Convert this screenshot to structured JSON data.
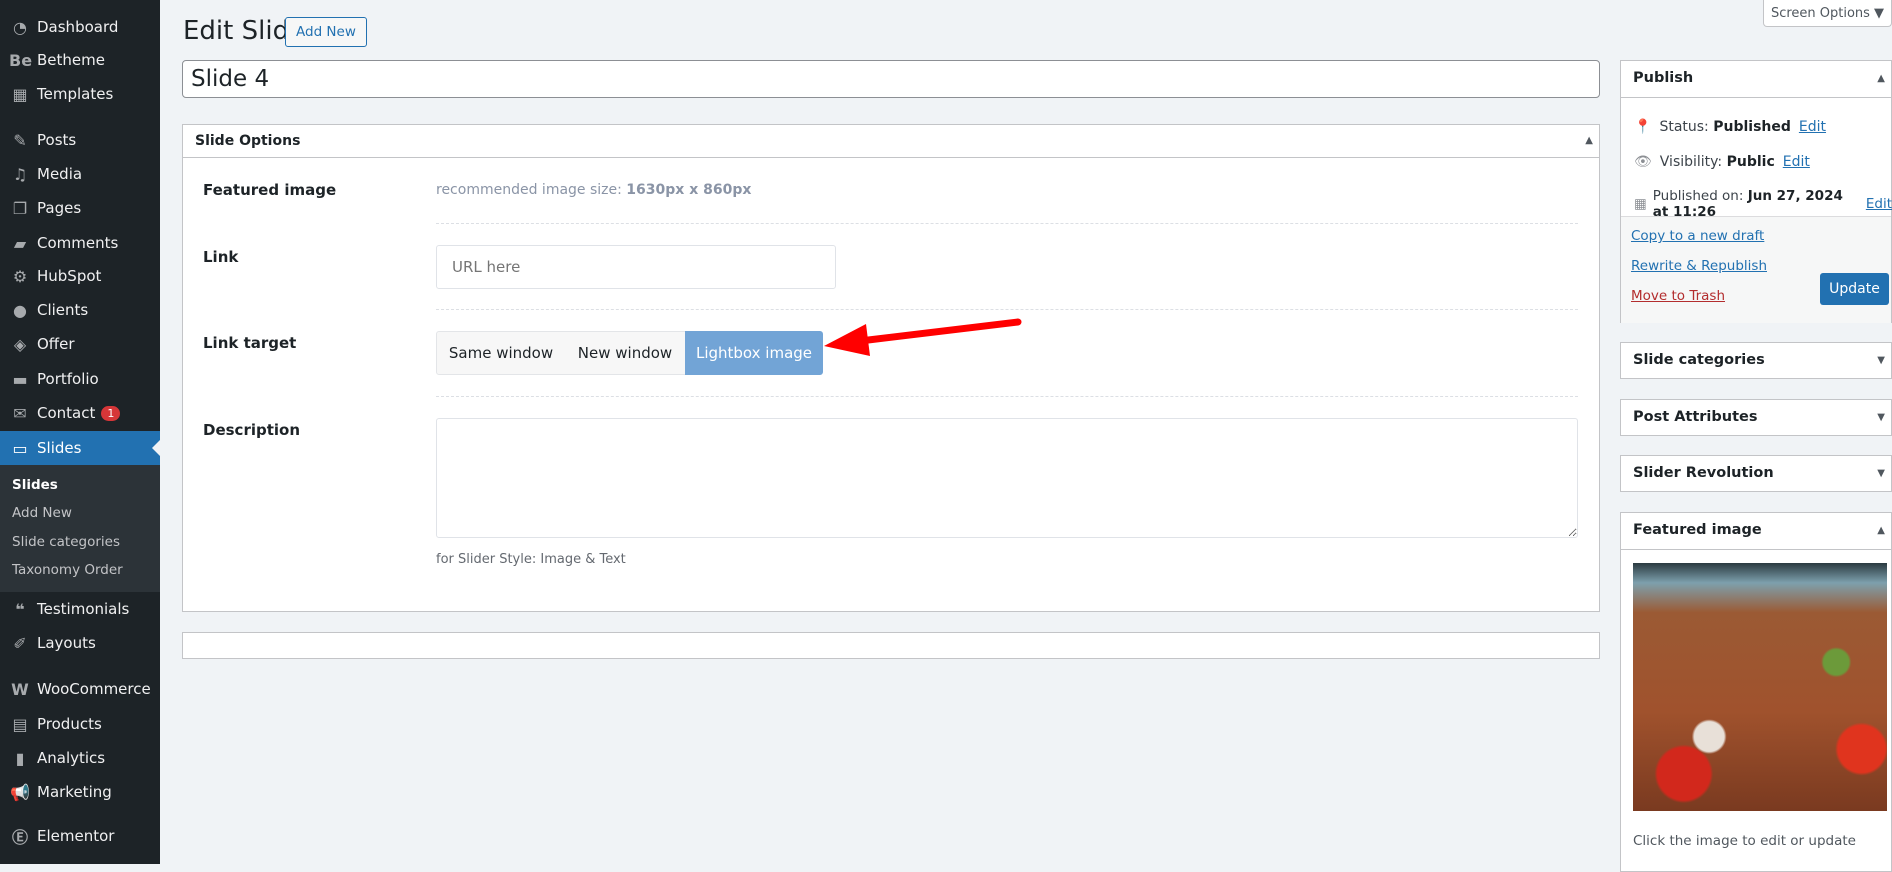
{
  "sidebar": {
    "items": [
      {
        "label": "Dashboard",
        "icon": "dashboard-icon",
        "glyph": "◔"
      },
      {
        "label": "Betheme",
        "icon": "betheme-icon",
        "glyph": "Be"
      },
      {
        "label": "Templates",
        "icon": "templates-icon",
        "glyph": "▦"
      },
      {
        "label": "Posts",
        "icon": "pin-icon",
        "glyph": "✎"
      },
      {
        "label": "Media",
        "icon": "media-icon",
        "glyph": "♫"
      },
      {
        "label": "Pages",
        "icon": "pages-icon",
        "glyph": "❐"
      },
      {
        "label": "Comments",
        "icon": "comment-icon",
        "glyph": "▰"
      },
      {
        "label": "HubSpot",
        "icon": "hubspot-icon",
        "glyph": "⚙"
      },
      {
        "label": "Clients",
        "icon": "clients-icon",
        "glyph": "●"
      },
      {
        "label": "Offer",
        "icon": "offer-icon",
        "glyph": "◈"
      },
      {
        "label": "Portfolio",
        "icon": "portfolio-icon",
        "glyph": "▬"
      },
      {
        "label": "Contact",
        "icon": "mail-icon",
        "glyph": "✉",
        "badge": "1"
      },
      {
        "label": "Slides",
        "icon": "slides-icon",
        "glyph": "▭",
        "active": true
      },
      {
        "label": "Testimonials",
        "icon": "quote-icon",
        "glyph": "❝"
      },
      {
        "label": "Layouts",
        "icon": "pencil-icon",
        "glyph": "✐"
      },
      {
        "label": "WooCommerce",
        "icon": "woocommerce-icon",
        "glyph": "W"
      },
      {
        "label": "Products",
        "icon": "archive-icon",
        "glyph": "▤"
      },
      {
        "label": "Analytics",
        "icon": "bar-chart-icon",
        "glyph": "▮"
      },
      {
        "label": "Marketing",
        "icon": "megaphone-icon",
        "glyph": "📢"
      },
      {
        "label": "Elementor",
        "icon": "elementor-icon",
        "glyph": "Ⓔ"
      }
    ],
    "submenu": [
      "Slides",
      "Add New",
      "Slide categories",
      "Taxonomy Order"
    ]
  },
  "header": {
    "title": "Edit Slide",
    "add_new": "Add New",
    "screen_options": "Screen Options ▼"
  },
  "post_title": "Slide 4",
  "slide_options": {
    "title": "Slide Options",
    "featured_label": "Featured image",
    "featured_hint": "recommended image size: ",
    "featured_size": "1630px x 860px",
    "link_label": "Link",
    "link_placeholder": "URL here",
    "target_label": "Link target",
    "targets": [
      "Same window",
      "New window",
      "Lightbox image"
    ],
    "selected_target": "Lightbox image",
    "description_label": "Description",
    "description_value": "",
    "description_hint": "for Slider Style: Image & Text"
  },
  "publish": {
    "title": "Publish",
    "status_label": "Status: ",
    "status": "Published",
    "visibility_label": "Visibility: ",
    "visibility": "Public",
    "published_label": "Published on: ",
    "published": "Jun 27, 2024 at 11:26",
    "edit": "Edit",
    "copy": "Copy to a new draft",
    "rewrite": "Rewrite & Republish",
    "trash": "Move to Trash",
    "update": "Update"
  },
  "panels": [
    "Slide categories",
    "Post Attributes",
    "Slider Revolution"
  ],
  "featured_image": {
    "title": "Featured image",
    "caption": "Click the image to edit or update"
  },
  "colors": {
    "accent": "#2271b1",
    "selected": "#72a4d6",
    "arrow": "#ff0000",
    "trash": "#b32d2e"
  }
}
